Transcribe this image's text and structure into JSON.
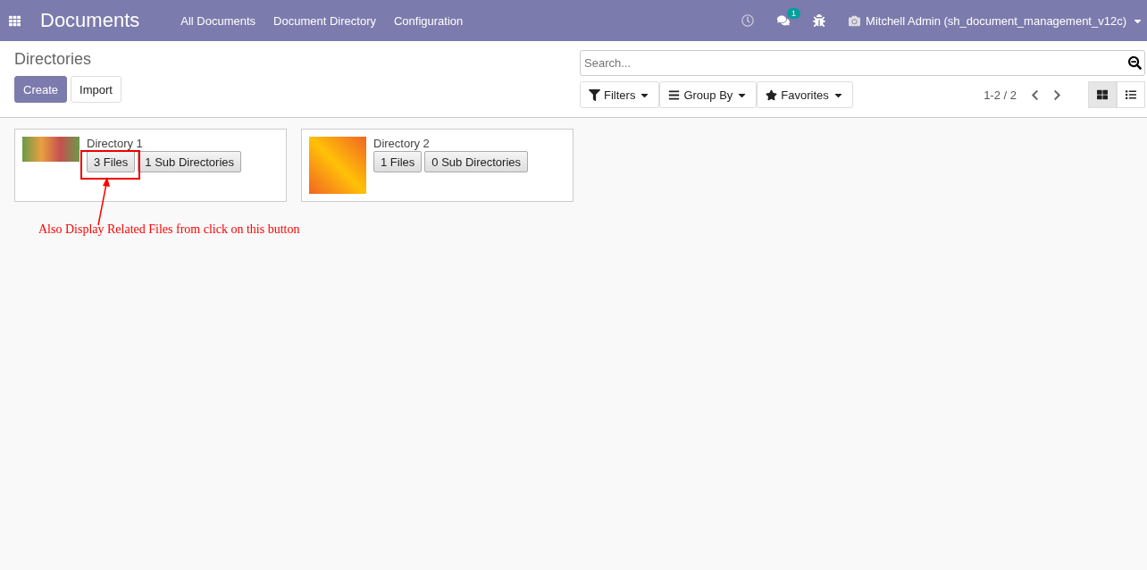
{
  "app": {
    "title": "Documents",
    "menu": [
      "All Documents",
      "Document Directory",
      "Configuration"
    ],
    "messages_badge": "1",
    "user": "Mitchell Admin (sh_document_management_v12c)"
  },
  "control_panel": {
    "breadcrumb": "Directories",
    "buttons": [
      "Create",
      "Import"
    ],
    "search": {
      "placeholder": "Search..."
    },
    "filters": [
      {
        "kind": "filter",
        "label": "Filters"
      },
      {
        "kind": "group",
        "label": "Group By"
      },
      {
        "kind": "favorite",
        "label": "Favorites"
      }
    ],
    "pager": "1-2 / 2",
    "views": [
      {
        "kind": "kanban",
        "selected": true
      },
      {
        "kind": "list",
        "selected": false
      }
    ]
  },
  "directories": [
    {
      "name": "Directory 1",
      "kind": "photo",
      "files": "3 Files",
      "sub_directories": "1 Sub Directories"
    },
    {
      "name": "Directory 2",
      "kind": "avatar",
      "files": "1 Files",
      "sub_directories": "0 Sub Directories"
    }
  ],
  "annotation": {
    "text": "Also Display Related Files from click on this button"
  }
}
